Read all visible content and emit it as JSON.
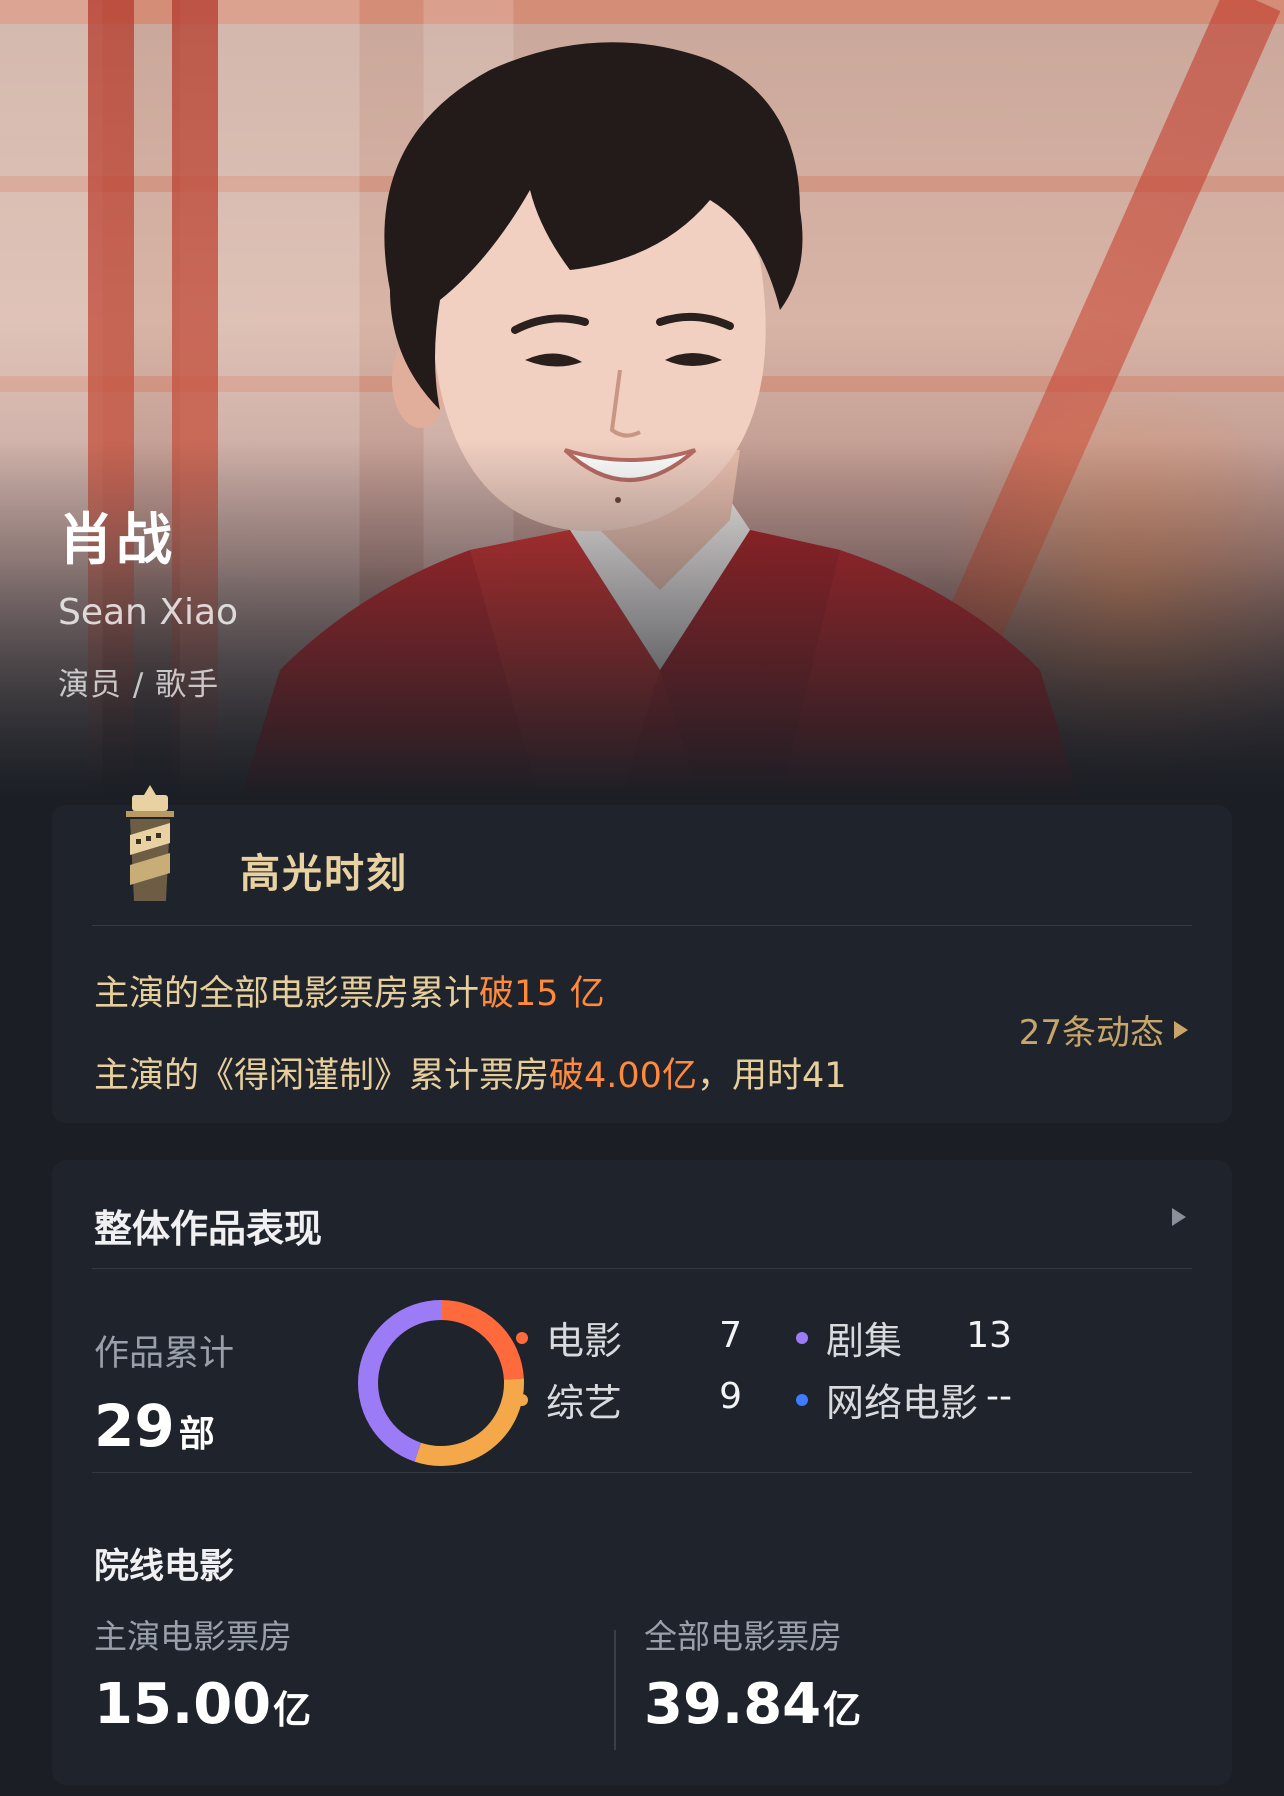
{
  "profile": {
    "name_cn": "肖战",
    "name_en": "Sean Xiao",
    "roles": "演员 / 歌手"
  },
  "highlight": {
    "icon": "film-tower-icon",
    "title": "高光时刻",
    "line1_prefix": "主演的全部电影票房累计",
    "line1_hot": "破15 亿",
    "line2_prefix": "主演的《得闲谨制》累计票房",
    "line2_hot": "破4.00亿",
    "line2_suffix": "，用时41",
    "more_label": "27条动态",
    "accent_color": "#e7cf9c",
    "hot_color": "#ff8a3d"
  },
  "overall": {
    "title": "整体作品表现",
    "works_label": "作品累计",
    "works_total": "29",
    "works_unit": "部",
    "categories": [
      {
        "label": "电影",
        "value": "7",
        "color": "#ff6a3d"
      },
      {
        "label": "剧集",
        "value": "13",
        "color": "#9b7cf6"
      },
      {
        "label": "综艺",
        "value": "9",
        "color": "#f5a84a"
      },
      {
        "label": "网络电影",
        "value": "--",
        "color": "#3d7bff"
      }
    ],
    "theatrical": {
      "title": "院线电影",
      "lead_label": "主演电影票房",
      "lead_value": "15.00",
      "lead_unit": "亿",
      "all_label": "全部电影票房",
      "all_value": "39.84",
      "all_unit": "亿"
    }
  },
  "chart_data": {
    "type": "pie",
    "categories": [
      "电影",
      "综艺",
      "剧集",
      "网络电影"
    ],
    "values": [
      7,
      9,
      13,
      0
    ],
    "colors": [
      "#ff6a3d",
      "#f5a84a",
      "#9b7cf6",
      "#3d7bff"
    ]
  }
}
